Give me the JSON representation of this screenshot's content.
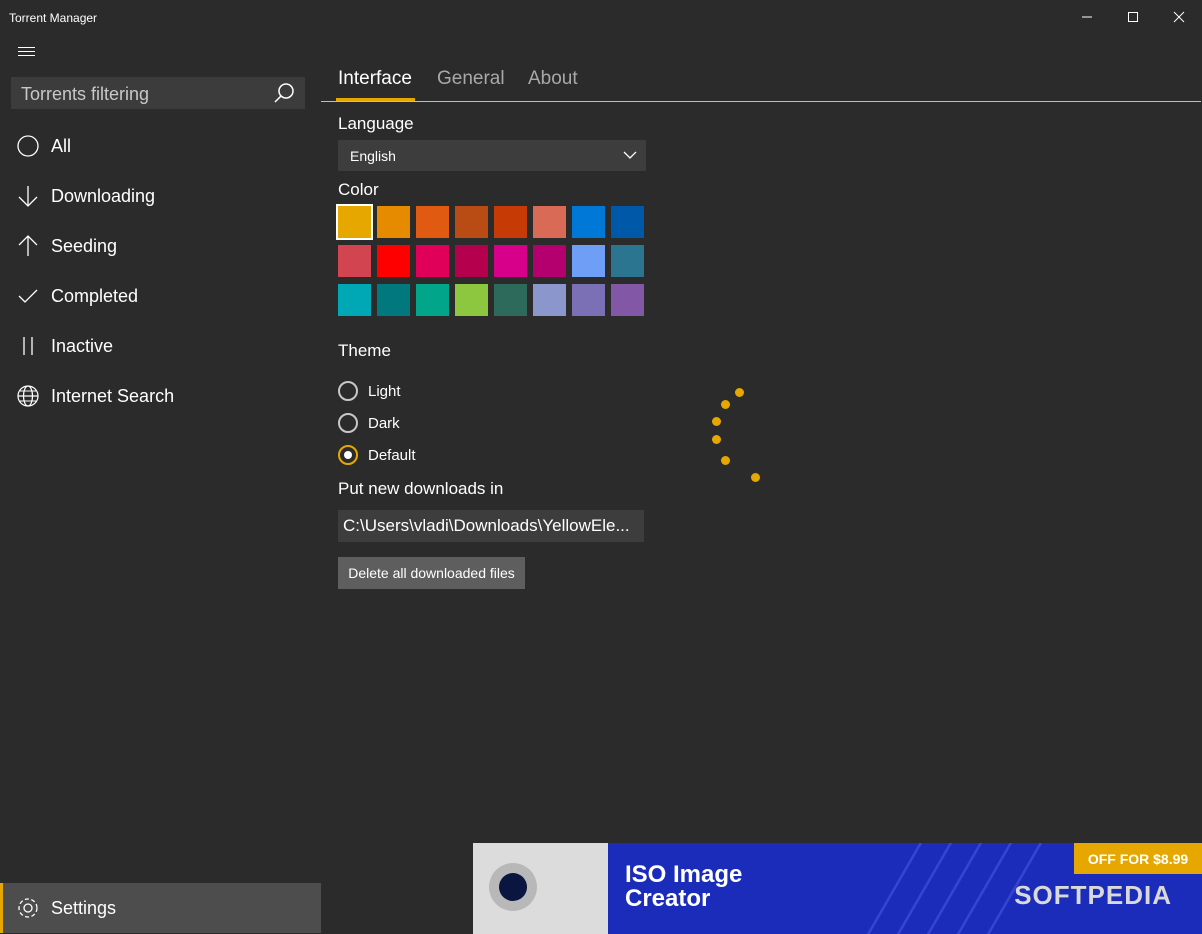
{
  "window": {
    "title": "Torrent Manager"
  },
  "sidebar": {
    "search_placeholder": "Torrents filtering",
    "items": [
      {
        "label": "All",
        "icon": "circle-icon"
      },
      {
        "label": "Downloading",
        "icon": "arrow-down-icon"
      },
      {
        "label": "Seeding",
        "icon": "arrow-up-icon"
      },
      {
        "label": "Completed",
        "icon": "checkmark-icon"
      },
      {
        "label": "Inactive",
        "icon": "pause-icon"
      },
      {
        "label": "Internet Search",
        "icon": "globe-icon"
      }
    ],
    "settings_label": "Settings"
  },
  "tabs": [
    {
      "label": "Interface",
      "active": true
    },
    {
      "label": "General",
      "active": false
    },
    {
      "label": "About",
      "active": false
    }
  ],
  "interface": {
    "language_label": "Language",
    "language_value": "English",
    "color_label": "Color",
    "colors": [
      "#e6a800",
      "#e68a00",
      "#e05a12",
      "#b84c14",
      "#c63a06",
      "#d96a55",
      "#0078d7",
      "#0058a8",
      "#d24450",
      "#ff0000",
      "#e0005a",
      "#b5004e",
      "#d6008a",
      "#b3006e",
      "#6e9ef5",
      "#2b7590",
      "#00a8b5",
      "#00787e",
      "#00a58a",
      "#8dc63f",
      "#2d6a5c",
      "#8a96cc",
      "#7b6fb5",
      "#8257a6"
    ],
    "selected_color": "#e6a800",
    "theme_label": "Theme",
    "theme_options": [
      "Light",
      "Dark",
      "Default"
    ],
    "theme_selected": "Default",
    "downloads_label": "Put new downloads in",
    "downloads_path": "C:\\Users\\vladi\\Downloads\\YellowEle...",
    "delete_button": "Delete all downloaded files"
  },
  "ad": {
    "title_line1": "ISO Image",
    "title_line2": "Creator",
    "offer": "OFF FOR  $8.99",
    "brand": "SOFTPEDIA"
  },
  "accent": "#e6a800"
}
